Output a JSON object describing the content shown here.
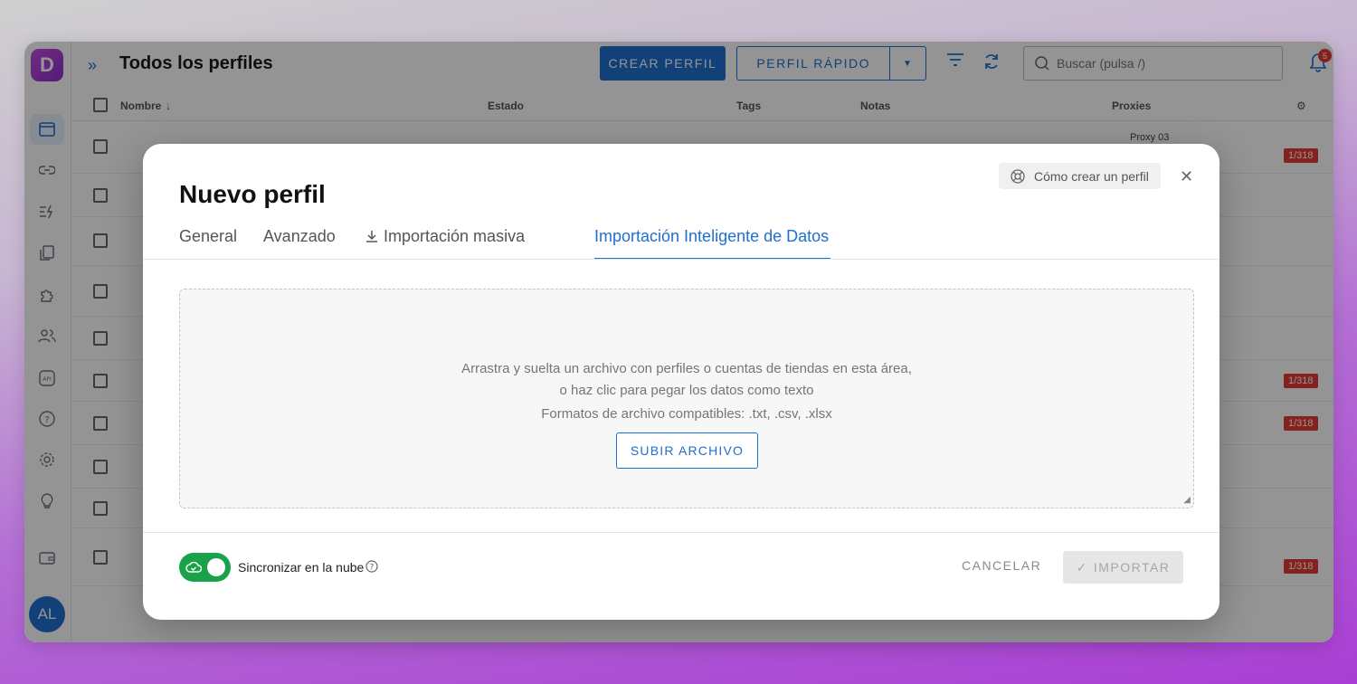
{
  "app": {
    "logo_letter": "D",
    "page_title": "Todos los perfiles",
    "create_button": "CREAR PERFIL",
    "quick_button": "PERFIL RÁPIDO",
    "search_placeholder": "Buscar (pulsa /)",
    "notification_count": "5",
    "avatar_initials": "AL",
    "accent_color": "#1f6fd0"
  },
  "table": {
    "columns": {
      "name": "Nombre",
      "status": "Estado",
      "tags": "Tags",
      "notes": "Notas",
      "proxies": "Proxies"
    },
    "first_proxy": "Proxy 03",
    "proxy_badge": "1/318"
  },
  "modal": {
    "title": "Nuevo perfil",
    "help_link": "Cómo crear un perfil",
    "tabs": {
      "general": "General",
      "advanced": "Avanzado",
      "bulk": "Importación masiva",
      "smart": "Importación Inteligente de Datos"
    },
    "dropzone": {
      "instructions": "Arrastra y suelta un archivo con perfiles o cuentas de tiendas en esta área, o haz clic para pegar los datos como texto",
      "formats": "Formatos de archivo compatibles: .txt, .csv, .xlsx",
      "upload_button": "SUBIR ARCHIVO"
    },
    "sync_label": "Sincronizar en la nube",
    "sync_enabled": true,
    "cancel_button": "CANCELAR",
    "import_button": "IMPORTAR"
  }
}
